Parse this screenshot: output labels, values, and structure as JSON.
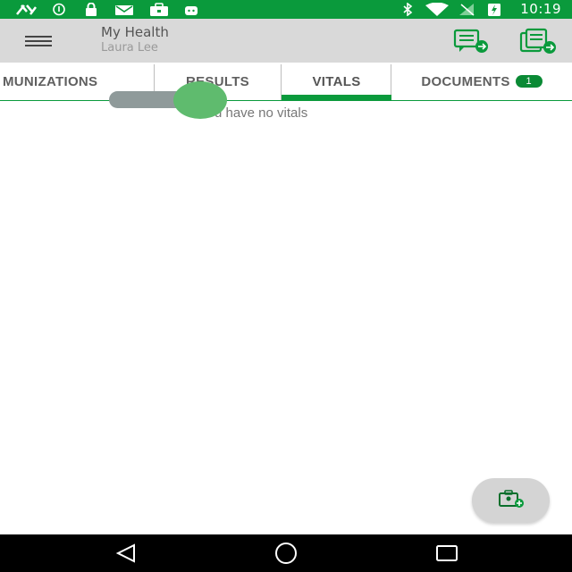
{
  "status_bar": {
    "time": "10:19",
    "left_icons": [
      "assistant-icon",
      "info-icon",
      "lock-icon",
      "mail-icon",
      "briefcase-icon",
      "android-icon"
    ],
    "right_icons": [
      "bluetooth-icon",
      "wifi-icon",
      "signal-icon",
      "battery-charging-icon"
    ]
  },
  "app_bar": {
    "title": "My Health",
    "subtitle": "Laura Lee",
    "actions": [
      "send-message-icon",
      "send-document-icon"
    ]
  },
  "tabs": [
    {
      "label": "MUNIZATIONS",
      "active": false
    },
    {
      "label": "RESULTS",
      "active": false
    },
    {
      "label": "VITALS",
      "active": true
    },
    {
      "label": "DOCUMENTS",
      "active": false,
      "badge": "1"
    }
  ],
  "main": {
    "empty_message": "You have no vitals"
  },
  "fab": {
    "icon": "add-vitals-icon"
  },
  "nav_bar": {
    "buttons": [
      "back-icon",
      "home-icon",
      "recents-icon"
    ]
  },
  "colors": {
    "status_bar": "#0a9a3c",
    "accent": "#0a9a3c",
    "app_bar": "#d9d9d9",
    "switch_thumb": "#5fbb6e",
    "switch_track": "#8f9a9a"
  }
}
